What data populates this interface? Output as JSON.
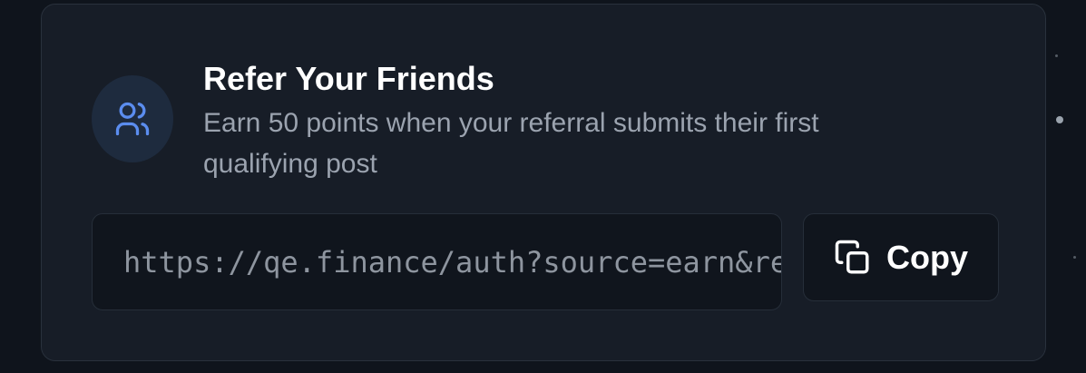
{
  "referral": {
    "title": "Refer Your Friends",
    "description": "Earn 50 points when your referral submits their first qualifying post",
    "link": "https://qe.finance/auth?source=earn&referral",
    "copy_label": "Copy",
    "icon": "users-icon",
    "copy_icon": "copy-icon"
  },
  "colors": {
    "background": "#0f141c",
    "card": "#171d27",
    "accent": "#5b8def",
    "text_primary": "#ffffff",
    "text_secondary": "#9ba3af"
  }
}
